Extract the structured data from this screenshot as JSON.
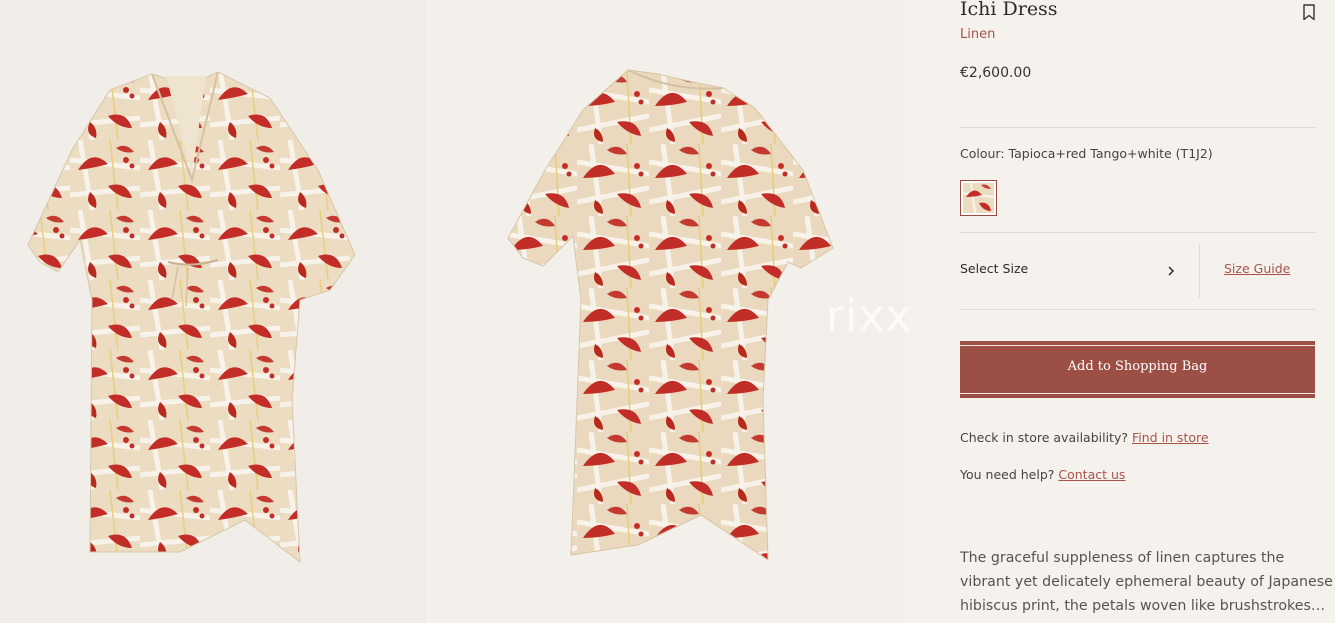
{
  "product": {
    "title": "Ichi Dress",
    "material": "Linen",
    "price": "€2,600.00",
    "colour_prefix": "Colour:",
    "colour_value": "Tapioca+red Tango+white (T1J2)",
    "swatch_color": "#c9302c"
  },
  "size": {
    "select_label": "Select Size",
    "guide_label": "Size Guide"
  },
  "actions": {
    "add_to_bag": "Add to Shopping Bag"
  },
  "help": {
    "store_question": "Check in store availability?",
    "store_link": "Find in store",
    "help_question": "You need help?",
    "help_link": "Contact us"
  },
  "description": {
    "lines": [
      "The graceful suppleness of linen captures the",
      "vibrant yet delicately ephemeral beauty of Japanese",
      "hibiscus print, the petals woven like brushstrokes…"
    ]
  },
  "gallery": {
    "watermark": "rixx"
  },
  "icons": {
    "bookmark": "bookmark-icon",
    "chevron": "chevron-right-icon"
  },
  "colors": {
    "accent": "#9c5045",
    "link": "#a6544a",
    "fabric": "#ecdcc2",
    "print": "#c22e27"
  }
}
